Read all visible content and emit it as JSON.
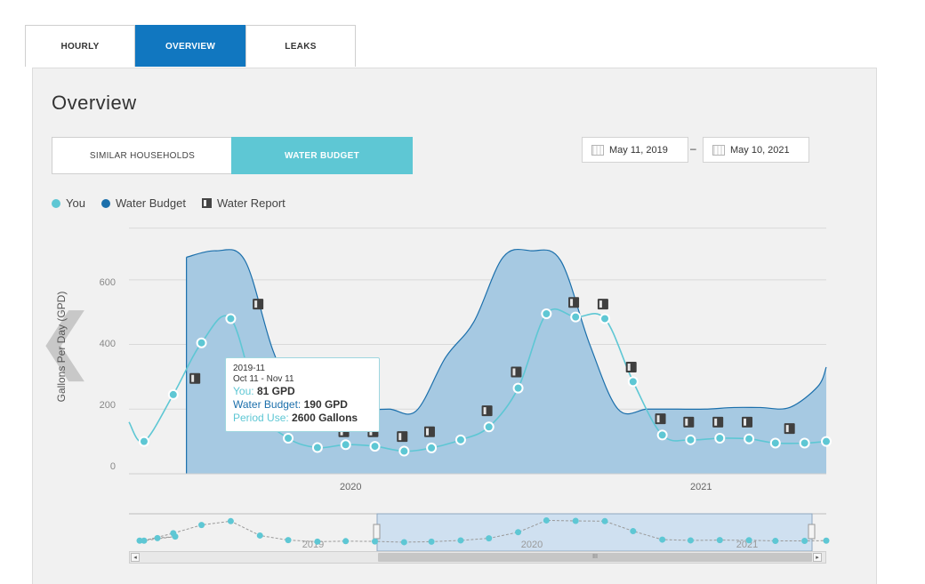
{
  "tabs": [
    {
      "label": "HOURLY",
      "active": false
    },
    {
      "label": "OVERVIEW",
      "active": true
    },
    {
      "label": "LEAKS",
      "active": false
    }
  ],
  "page_title": "Overview",
  "segments": [
    {
      "label": "SIMILAR HOUSEHOLDS",
      "active": false
    },
    {
      "label": "WATER BUDGET",
      "active": true
    }
  ],
  "date_range": {
    "start": "May 11, 2019",
    "separator": "–",
    "end": "May 10, 2021"
  },
  "legend": {
    "you": "You",
    "budget": "Water Budget",
    "report": "Water Report"
  },
  "colors": {
    "you": "#5ec7d4",
    "budget": "#1b6fab",
    "budget_fill": "#a6c9e2",
    "active_tab": "#1177c0",
    "segment_active": "#5ec7d4"
  },
  "tooltip": {
    "period": "2019-11",
    "range": "Oct 11 - Nov 11",
    "you_label": "You:",
    "you_value": "81 GPD",
    "budget_label": "Water Budget:",
    "budget_value": "190 GPD",
    "period_label": "Period Use:",
    "period_value": "2600 Gallons"
  },
  "navigator": {
    "labels": [
      "2019",
      "2020",
      "2021"
    ],
    "scroll_center": "III"
  },
  "chart_data": {
    "type": "area",
    "ylabel": "Gallons Per Day (GPD)",
    "xlabel": "",
    "y_ticks": [
      "0",
      "200",
      "400",
      "600"
    ],
    "x_ticks": [
      "2020",
      "2021"
    ],
    "ylim": [
      0,
      770
    ],
    "grid": true,
    "legend_position": "top-left",
    "series": [
      {
        "name": "You",
        "type": "line",
        "x": [
          "2019-05-17",
          "2019-06-17",
          "2019-07-17",
          "2019-08-17",
          "2019-09-17",
          "2019-10-17",
          "2019-11-17",
          "2019-12-17",
          "2020-01-17",
          "2020-02-17",
          "2020-03-17",
          "2020-04-17",
          "2020-05-17",
          "2020-06-17",
          "2020-07-17",
          "2020-08-17",
          "2020-09-17",
          "2020-10-17",
          "2020-11-17",
          "2020-12-17",
          "2021-01-17",
          "2021-02-17",
          "2021-03-17",
          "2021-04-17",
          "2021-05-10"
        ],
        "values": [
          100,
          245,
          405,
          480,
          200,
          110,
          81,
          90,
          85,
          70,
          80,
          105,
          145,
          265,
          495,
          485,
          480,
          285,
          120,
          105,
          110,
          108,
          95,
          95,
          100
        ]
      },
      {
        "name": "Water Budget",
        "type": "area",
        "x": [
          "2019-07-01",
          "2019-08-01",
          "2019-09-01",
          "2019-10-01",
          "2019-11-01",
          "2019-12-01",
          "2020-01-01",
          "2020-02-01",
          "2020-03-01",
          "2020-04-01",
          "2020-05-01",
          "2020-06-01",
          "2020-07-01",
          "2020-08-01",
          "2020-09-01",
          "2020-10-01",
          "2020-11-01",
          "2020-12-01",
          "2021-01-01",
          "2021-02-01",
          "2021-03-01",
          "2021-04-01",
          "2021-05-01",
          "2021-05-10"
        ],
        "values": [
          670,
          690,
          660,
          380,
          190,
          190,
          195,
          200,
          195,
          360,
          470,
          670,
          690,
          660,
          400,
          200,
          200,
          200,
          200,
          205,
          205,
          205,
          270,
          330
        ]
      }
    ],
    "water_reports": {
      "x": [
        "2019-07-10",
        "2019-09-15",
        "2019-12-15",
        "2020-01-15",
        "2020-02-15",
        "2020-03-15",
        "2020-05-15",
        "2020-06-15",
        "2020-08-15",
        "2020-09-15",
        "2020-10-15",
        "2020-11-15",
        "2020-12-15",
        "2021-01-15",
        "2021-02-15",
        "2021-04-01"
      ],
      "values": [
        295,
        525,
        130,
        130,
        115,
        130,
        195,
        315,
        530,
        525,
        330,
        170,
        160,
        160,
        160,
        140
      ]
    }
  }
}
